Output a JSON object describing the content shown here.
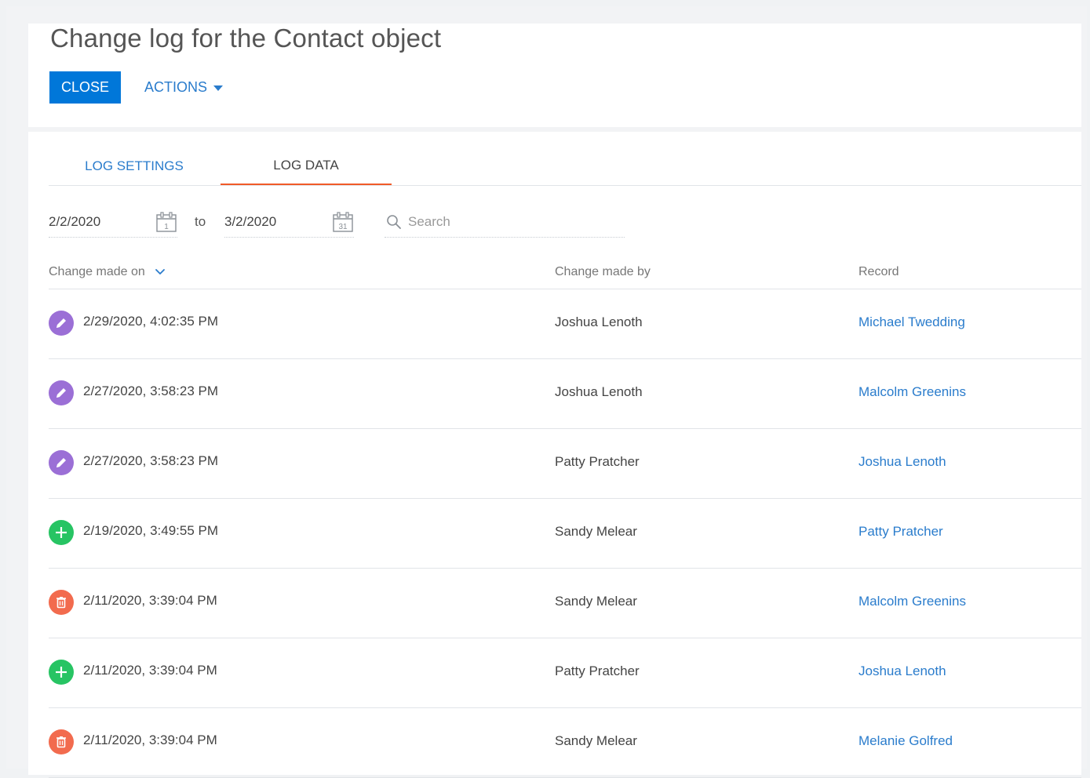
{
  "header": {
    "title": "Change log for the Contact object",
    "close_label": "CLOSE",
    "actions_label": "ACTIONS"
  },
  "tabs": [
    {
      "label": "LOG SETTINGS",
      "active": false
    },
    {
      "label": "LOG DATA",
      "active": true
    }
  ],
  "filters": {
    "date_from": "2/2/2020",
    "date_from_icon_day": "1",
    "to_label": "to",
    "date_to": "3/2/2020",
    "date_to_icon_day": "31",
    "search_placeholder": "Search"
  },
  "table": {
    "columns": [
      "Change made on",
      "Change made by",
      "Record"
    ],
    "rows": [
      {
        "type": "edit",
        "date": "2/29/2020, 4:02:35 PM",
        "by": "Joshua Lenoth",
        "record": "Michael Twedding"
      },
      {
        "type": "edit",
        "date": "2/27/2020, 3:58:23 PM",
        "by": "Joshua Lenoth",
        "record": "Malcolm Greenins"
      },
      {
        "type": "edit",
        "date": "2/27/2020, 3:58:23 PM",
        "by": "Patty Pratcher",
        "record": "Joshua Lenoth"
      },
      {
        "type": "add",
        "date": "2/19/2020, 3:49:55 PM",
        "by": "Sandy Melear",
        "record": "Patty Pratcher"
      },
      {
        "type": "delete",
        "date": "2/11/2020, 3:39:04 PM",
        "by": "Sandy Melear",
        "record": "Malcolm Greenins"
      },
      {
        "type": "add",
        "date": "2/11/2020, 3:39:04 PM",
        "by": "Patty Pratcher",
        "record": "Joshua Lenoth"
      },
      {
        "type": "delete",
        "date": "2/11/2020, 3:39:04 PM",
        "by": "Sandy Melear",
        "record": "Melanie Golfred"
      }
    ]
  },
  "colors": {
    "primary": "#0077d9",
    "link": "#2a7ccc",
    "tab_active_underline": "#f05a28",
    "edit_icon": "#9b6fd6",
    "add_icon": "#27c463",
    "delete_icon": "#f26b4e"
  }
}
